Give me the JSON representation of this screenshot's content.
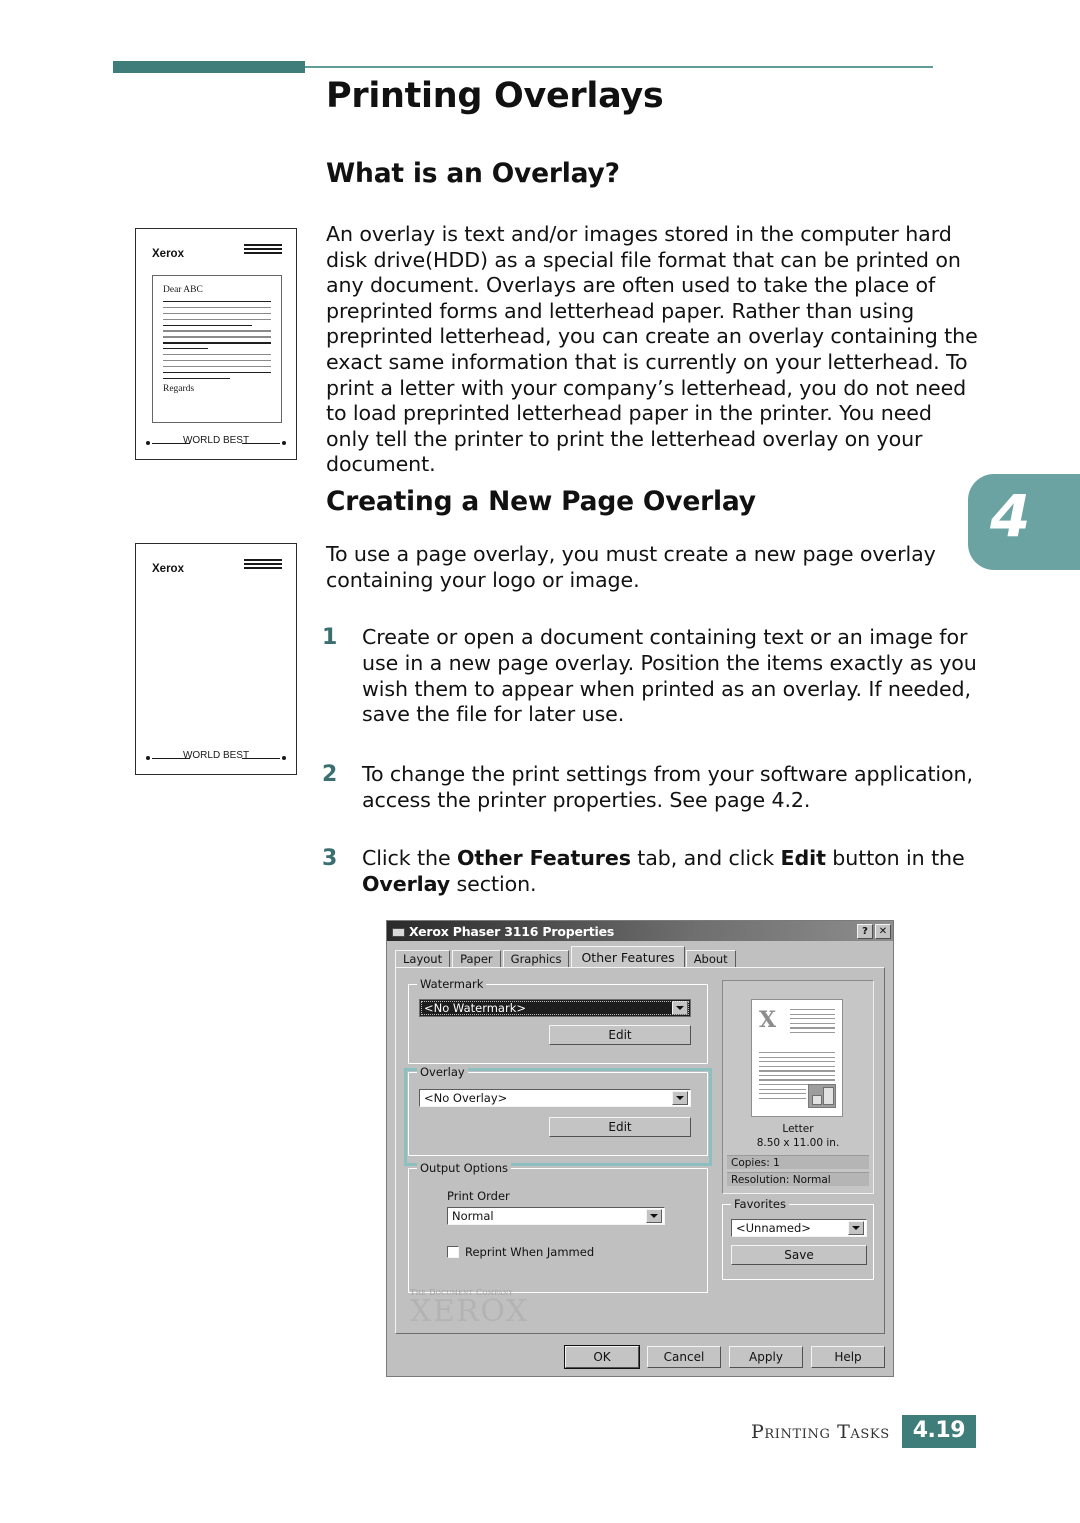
{
  "page": {
    "title": "Printing Overlays",
    "chapter_tab": "4"
  },
  "sections": {
    "what_is_overlay": {
      "heading": "What is an Overlay?",
      "paragraph": "An overlay is text and/or images stored in the computer hard disk drive(HDD) as a special file format that can be printed on any document. Overlays are often used to take the place of preprinted forms and letterhead paper. Rather than using preprinted letterhead, you can create an overlay containing the exact same information that is currently on your letterhead. To print a letter with your company’s letterhead, you do not need to load preprinted letterhead paper in the printer. You need only tell the printer to print the letterhead overlay on your document."
    },
    "creating_overlay": {
      "heading": "Creating a New Page Overlay",
      "intro": "To use a page overlay, you must create a new page overlay containing your logo or image.",
      "steps": [
        {
          "number": "1",
          "text": "Create or open a document containing text or an image for use in a new page overlay. Position the items exactly as you wish them to appear when printed as an overlay. If needed, save the file for later use."
        },
        {
          "number": "2",
          "text": "To change the print settings from your software application, access the printer properties. See page 4.2."
        },
        {
          "number": "3",
          "text_parts": [
            {
              "t": "Click the ",
              "b": false
            },
            {
              "t": "Other Features",
              "b": true
            },
            {
              "t": " tab, and click ",
              "b": false
            },
            {
              "t": "Edit",
              "b": true
            },
            {
              "t": " button in the ",
              "b": false
            },
            {
              "t": "Overlay",
              "b": true
            },
            {
              "t": " section.",
              "b": false
            }
          ]
        }
      ]
    }
  },
  "figures": {
    "letter_with_content": {
      "brand": "Xerox",
      "salutation": "Dear ABC",
      "closing": "Regards",
      "footer_text": "WORLD BEST"
    },
    "letter_blank": {
      "brand": "Xerox",
      "footer_text": "WORLD BEST"
    }
  },
  "dialog": {
    "title": "Xerox Phaser 3116 Properties",
    "titlebar_buttons": [
      {
        "label": "?",
        "name": "help-button"
      },
      {
        "label": "✕",
        "name": "close-button"
      }
    ],
    "tabs": [
      {
        "label": "Layout",
        "active": false
      },
      {
        "label": "Paper",
        "active": false
      },
      {
        "label": "Graphics",
        "active": false
      },
      {
        "label": "Other Features",
        "active": true
      },
      {
        "label": "About",
        "active": false
      }
    ],
    "watermark": {
      "group_label": "Watermark",
      "value": "<No Watermark>",
      "edit_label": "Edit"
    },
    "overlay": {
      "group_label": "Overlay",
      "value": "<No Overlay>",
      "edit_label": "Edit",
      "highlight_color": "#8cc0c0"
    },
    "output_options": {
      "group_label": "Output Options",
      "print_order_label": "Print Order",
      "print_order_value": "Normal",
      "reprint_label": "Reprint When Jammed",
      "reprint_checked": false
    },
    "preview": {
      "paper_name": "Letter",
      "paper_size": "8.50 x 11.00 in.",
      "copies": "Copies: 1",
      "resolution": "Resolution: Normal"
    },
    "favorites": {
      "group_label": "Favorites",
      "value": "<Unnamed>",
      "save_label": "Save"
    },
    "logo": {
      "tagline": "The Document Company",
      "wordmark": "XEROX"
    },
    "buttons": [
      {
        "label": "OK",
        "default": true
      },
      {
        "label": "Cancel",
        "default": false
      },
      {
        "label": "Apply",
        "default": false
      },
      {
        "label": "Help",
        "default": false
      }
    ]
  },
  "footer": {
    "section": "Printing Tasks",
    "page_number": "4.19"
  }
}
